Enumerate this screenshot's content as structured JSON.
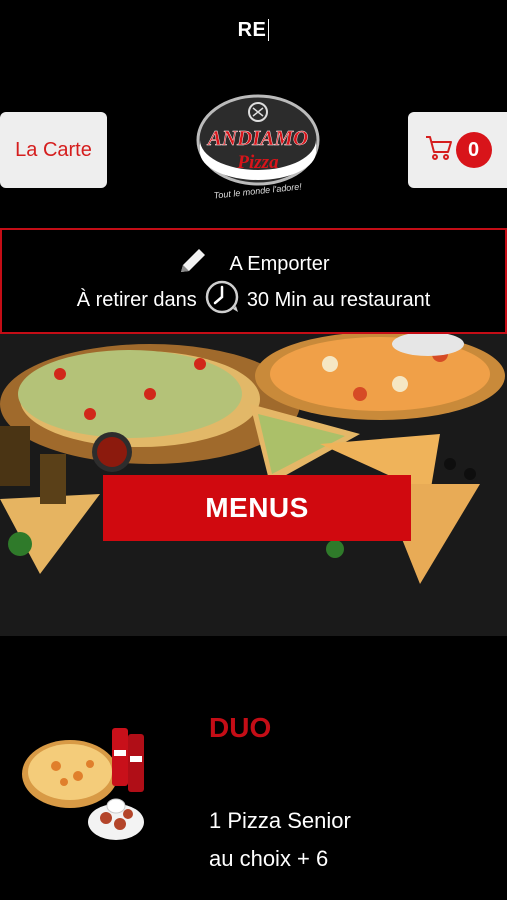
{
  "status": {
    "text": "RE"
  },
  "header": {
    "carte_label": "La Carte",
    "cart_count": "0",
    "logo": {
      "brand": "ANDIAMO",
      "sub": "Pizza",
      "tagline": "Tout le monde l'adore!"
    }
  },
  "order": {
    "mode": "A Emporter",
    "pickup_prefix": "À retirer dans",
    "pickup_suffix": "30 Min au restaurant"
  },
  "hero": {
    "button_label": "MENUS"
  },
  "product": {
    "title": "DUO",
    "description_line1": "1 Pizza Senior",
    "description_line2": "au choix + 6"
  },
  "colors": {
    "accent": "#d0090f",
    "background": "#000000",
    "button_bg": "#eeeeee"
  }
}
